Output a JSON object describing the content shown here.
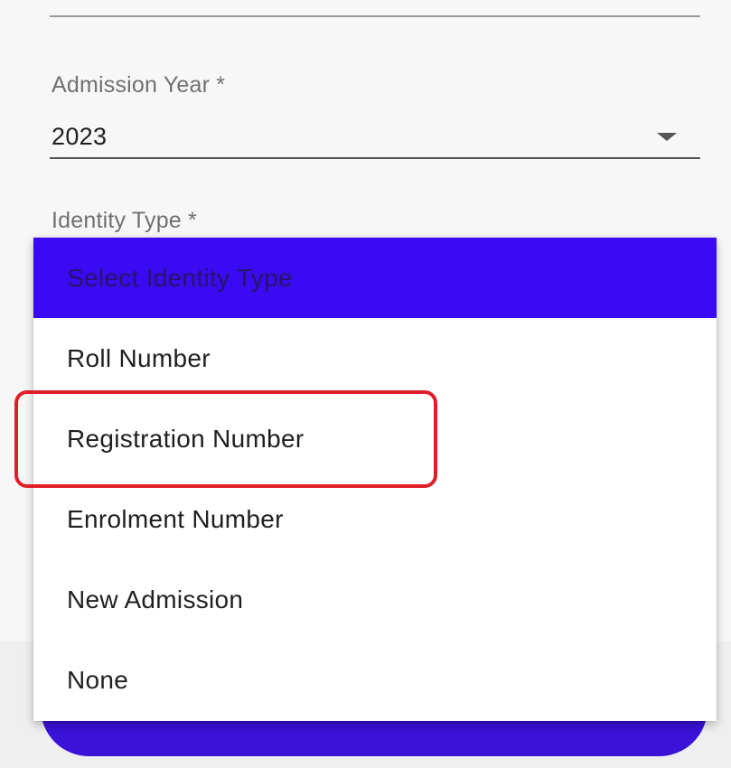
{
  "form": {
    "admission_year": {
      "label": "Admission Year *",
      "value": "2023"
    },
    "identity_type": {
      "label": "Identity Type *"
    }
  },
  "identity_menu": {
    "header": "Select Identity Type",
    "options": [
      {
        "label": "Roll Number"
      },
      {
        "label": "Registration Number",
        "highlighted": true
      },
      {
        "label": "Enrolment Number"
      },
      {
        "label": "New Admission"
      },
      {
        "label": "None"
      }
    ]
  },
  "colors": {
    "accent": "#3a0bf2",
    "button": "#3a12d8",
    "highlight": "#e01e2a"
  }
}
